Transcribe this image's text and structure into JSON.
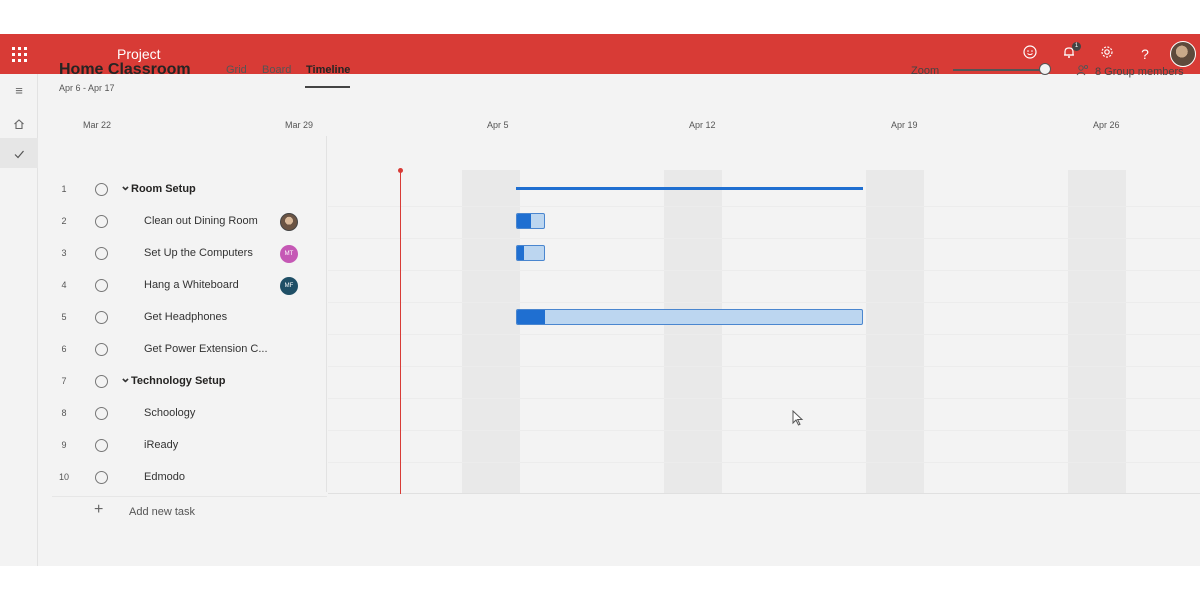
{
  "app": {
    "title": "Project",
    "accent": "#d83b36"
  },
  "topbar": {
    "icons": [
      "waffle-icon",
      "feedback-smiley-icon",
      "notification-bell-icon",
      "settings-gear-icon",
      "help-icon",
      "user-avatar"
    ],
    "notification_count": "1"
  },
  "rail": {
    "icons": [
      "hamburger-icon",
      "home-icon",
      "checkmark-icon"
    ]
  },
  "plan": {
    "title": "Home Classroom",
    "dates": "Apr 6 - Apr 17"
  },
  "tabs": [
    {
      "label": "Grid",
      "active": false
    },
    {
      "label": "Board",
      "active": false
    },
    {
      "label": "Timeline",
      "active": true
    }
  ],
  "zoom": {
    "label": "Zoom",
    "level": 1.0
  },
  "members": {
    "label": "8 Group members"
  },
  "timeline": {
    "dates": [
      "Mar 22",
      "Mar 29",
      "Apr 5",
      "Apr 12",
      "Apr 19",
      "Apr 26"
    ]
  },
  "tasks": [
    {
      "num": "1",
      "label": "Room Setup",
      "group": true
    },
    {
      "num": "2",
      "label": "Clean out Dining Room",
      "group": false,
      "assignee": {
        "initials": "",
        "color": "#6b5444",
        "type": "photo"
      }
    },
    {
      "num": "3",
      "label": "Set Up the Computers",
      "group": false,
      "assignee": {
        "initials": "MT",
        "color": "#c558b5"
      }
    },
    {
      "num": "4",
      "label": "Hang a Whiteboard",
      "group": false,
      "assignee": {
        "initials": "MF",
        "color": "#1f4f66"
      }
    },
    {
      "num": "5",
      "label": "Get Headphones",
      "group": false
    },
    {
      "num": "6",
      "label": "Get Power Extension C...",
      "group": false
    },
    {
      "num": "7",
      "label": "Technology Setup",
      "group": true
    },
    {
      "num": "8",
      "label": "Schoology",
      "group": false
    },
    {
      "num": "9",
      "label": "iReady",
      "group": false
    },
    {
      "num": "10",
      "label": "Edmodo",
      "group": false
    }
  ],
  "add_task": {
    "label": "Add new task"
  },
  "bars": {
    "summary": {
      "row": 1,
      "start": "Apr 6",
      "end": "Apr 17"
    },
    "tasks": [
      {
        "row": 2,
        "start": "Apr 6",
        "end": "Apr 7",
        "progress": 0.5
      },
      {
        "row": 3,
        "start": "Apr 6",
        "end": "Apr 7",
        "progress": 0.25
      },
      {
        "row": 5,
        "start": "Apr 6",
        "end": "Apr 17",
        "progress": 0.08
      }
    ]
  }
}
